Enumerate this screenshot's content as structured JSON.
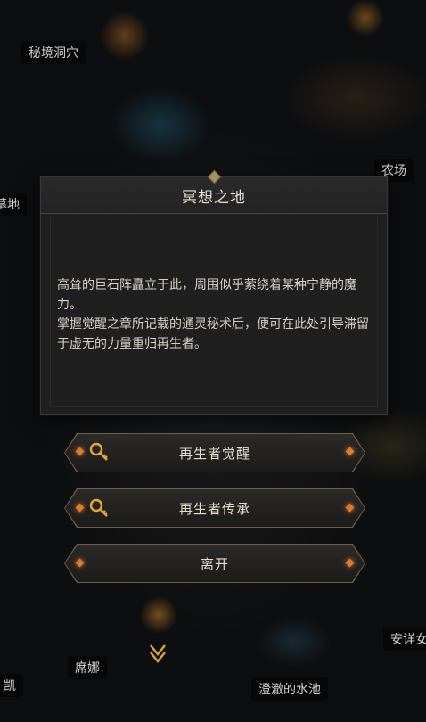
{
  "map": {
    "places": [
      {
        "id": "mijing-dongxue",
        "label": "秘境洞穴"
      },
      {
        "id": "nongchang",
        "label": "农场"
      },
      {
        "id": "left-edge-1",
        "label": "墓地"
      },
      {
        "id": "xina",
        "label": "席娜"
      },
      {
        "id": "chengche-shuichi",
        "label": "澄澈的水池"
      },
      {
        "id": "anxiang",
        "label": "安详女"
      },
      {
        "id": "left-edge-2",
        "label": "凯"
      }
    ]
  },
  "dialog": {
    "title": "冥想之地",
    "paragraph_1": "高耸的巨石阵矗立于此，周围似乎萦绕着某种宁静的魔力。",
    "paragraph_2": "掌握觉醒之章所记载的通灵秘术后，便可在此处引导滞留于虚无的力量重归再生者。"
  },
  "buttons": {
    "awaken": "再生者觉醒",
    "inherit": "再生者传承",
    "leave": "离开"
  },
  "icons": {
    "button_key": "magnifier-key-icon",
    "button_diamond": "orange-diamond-icon",
    "map_marker": "location-chevron-icon"
  },
  "colors": {
    "accent_orange": "#e07b2e",
    "gold": "#d8a13a",
    "panel": "#1f1f20"
  }
}
